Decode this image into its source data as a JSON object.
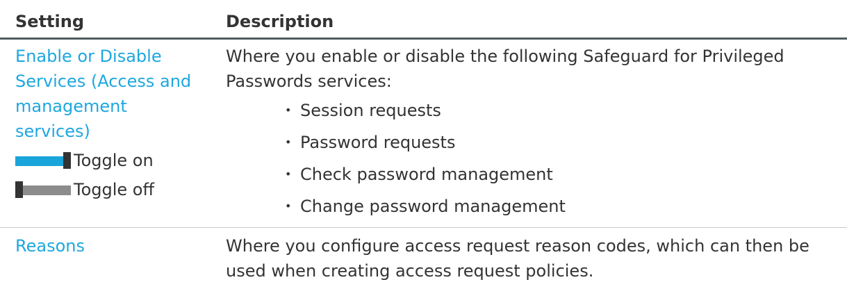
{
  "table": {
    "headers": {
      "setting": "Setting",
      "description": "Description"
    },
    "rows": [
      {
        "setting_link": "Enable or Disable Services (Access and management services)",
        "toggle_on_label": "Toggle on",
        "toggle_off_label": "Toggle off",
        "description": "Where you enable or disable the following Safeguard for Privileged Passwords services:",
        "services": [
          "Session requests",
          "Password requests",
          "Check password management",
          "Change password management"
        ]
      },
      {
        "setting_link": "Reasons",
        "description": "Where you configure access request reason codes, which can then be used when creating access request policies."
      }
    ]
  },
  "colors": {
    "link": "#1ea7df",
    "text": "#333333",
    "toggle_on": "#1aa5da",
    "toggle_off": "#8c8c8c",
    "header_rule": "#4d5b5f"
  },
  "icons": {
    "toggle_on": "toggle-on-icon",
    "toggle_off": "toggle-off-icon",
    "bullet": "•"
  }
}
